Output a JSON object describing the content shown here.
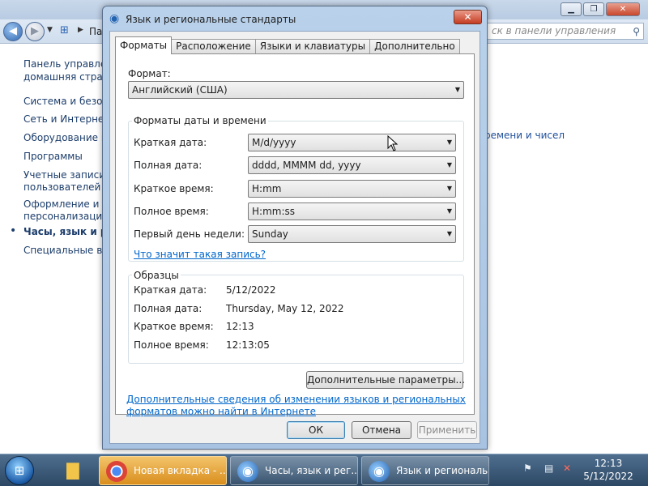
{
  "background": {
    "breadcrumb_first": "Па",
    "search_placeholder": "ск в панели управления",
    "sidebar": [
      "Панель управлен",
      "домашняя страни",
      "Система и безопа",
      "Сеть и Интернет",
      "Оборудование и з",
      "Программы",
      "Учетные записи",
      "пользователей",
      "Оформление и",
      "персонализация",
      "Часы, язык и ре",
      "Специальные воз"
    ],
    "right_link": "ремени и чисел"
  },
  "dialog": {
    "title": "Язык и региональные стандарты",
    "tabs": [
      "Форматы",
      "Расположение",
      "Языки и клавиатуры",
      "Дополнительно"
    ],
    "format_label": "Формат:",
    "format_value": "Английский (США)",
    "datetime_group": "Форматы даты и времени",
    "fields": [
      {
        "label": "Краткая дата:",
        "value": "M/d/yyyy"
      },
      {
        "label": "Полная дата:",
        "value": "dddd, MMMM dd, yyyy"
      },
      {
        "label": "Краткое время:",
        "value": "H:mm"
      },
      {
        "label": "Полное время:",
        "value": "H:mm:ss"
      },
      {
        "label": "Первый день недели:",
        "value": "Sunday"
      }
    ],
    "notation_link": "Что значит такая запись?",
    "samples_group": "Образцы",
    "samples": [
      {
        "label": "Краткая дата:",
        "value": "5/12/2022"
      },
      {
        "label": "Полная дата:",
        "value": "Thursday, May 12, 2022"
      },
      {
        "label": "Краткое время:",
        "value": "12:13"
      },
      {
        "label": "Полное время:",
        "value": "12:13:05"
      }
    ],
    "advanced_button": "Дополнительные параметры...",
    "info_link_line1": "Дополнительные сведения об изменении языков и региональных",
    "info_link_line2": "форматов можно найти в Интернете",
    "ok": "ОК",
    "cancel": "Отмена",
    "apply": "Применить"
  },
  "taskbar": {
    "items": [
      "Новая вкладка - ...",
      "Часы, язык и рег...",
      "Язык и региональ..."
    ],
    "time": "12:13",
    "date": "5/12/2022"
  }
}
